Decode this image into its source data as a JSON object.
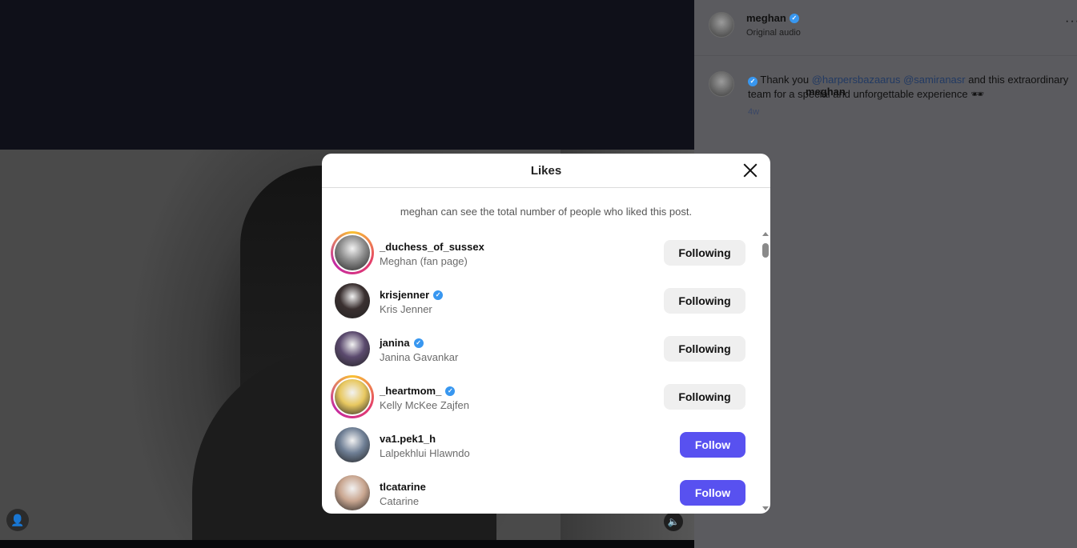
{
  "post": {
    "author": "meghan",
    "audio": "Original audio",
    "more_label": "···",
    "caption_user": "meghan",
    "caption_text_1": "Thank you ",
    "mention_1": "@harpersbazaarus",
    "mention_2": "@samiranasr",
    "caption_text_2": " and this extraordinary team for a special and unforgettable experience 🕶",
    "time": "4w"
  },
  "modal": {
    "title": "Likes",
    "notice": "meghan can see the total number of people who liked this post."
  },
  "likes": [
    {
      "username": "_duchess_of_sussex",
      "fullname": "Meghan (fan page)",
      "verified": false,
      "ring": true,
      "button": "Following",
      "avatar_color": "#8c8c8c"
    },
    {
      "username": "krisjenner",
      "fullname": "Kris Jenner",
      "verified": true,
      "ring": false,
      "button": "Following",
      "avatar_color": "#3a3030"
    },
    {
      "username": "janina",
      "fullname": "Janina Gavankar",
      "verified": true,
      "ring": false,
      "button": "Following",
      "avatar_color": "#5b4a6e"
    },
    {
      "username": "_heartmom_",
      "fullname": "Kelly McKee Zajfen",
      "verified": true,
      "ring": true,
      "button": "Following",
      "avatar_color": "#e8c860"
    },
    {
      "username": "va1.pek1_h",
      "fullname": "Lalpekhlui Hlawndo",
      "verified": false,
      "ring": false,
      "button": "Follow",
      "avatar_color": "#6f7f95"
    },
    {
      "username": "tlcatarine",
      "fullname": "Catarine",
      "verified": false,
      "ring": false,
      "button": "Follow",
      "avatar_color": "#c9a690"
    }
  ],
  "colors": {
    "follow_button": "#5851f0",
    "following_button": "#efefef",
    "verified_badge": "#3897f0"
  }
}
